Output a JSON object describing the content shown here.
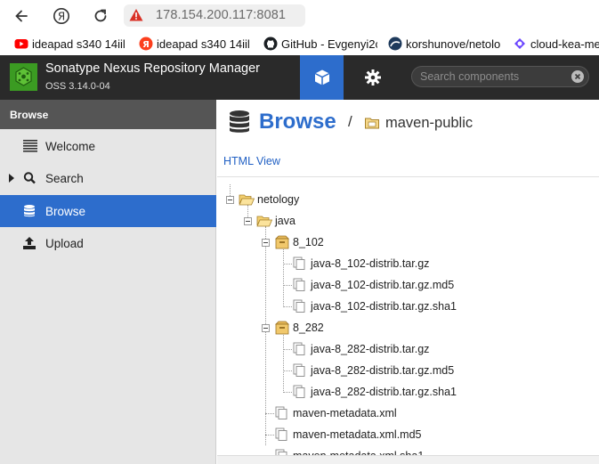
{
  "browser": {
    "url": "178.154.200.117:8081",
    "bookmarks": [
      {
        "label": "ideapad s340 14iil",
        "icon": "youtube-icon"
      },
      {
        "label": "ideapad s340 14iil",
        "icon": "yandex-icon"
      },
      {
        "label": "GitHub - Evgenyi2c",
        "icon": "github-icon"
      },
      {
        "label": "korshunove/netolo",
        "icon": "netology-icon"
      },
      {
        "label": "cloud-kea-me",
        "icon": "cloud-icon"
      }
    ]
  },
  "header": {
    "title": "Sonatype Nexus Repository Manager",
    "version": "OSS 3.14.0-04",
    "search_placeholder": "Search components"
  },
  "sidebar": {
    "heading": "Browse",
    "items": [
      {
        "label": "Welcome",
        "icon": "list-icon"
      },
      {
        "label": "Search",
        "icon": "search-icon"
      },
      {
        "label": "Browse",
        "icon": "database-icon"
      },
      {
        "label": "Upload",
        "icon": "upload-icon"
      }
    ]
  },
  "main": {
    "title": "Browse",
    "separator": "/",
    "repository": "maven-public",
    "html_view": "HTML View",
    "tree": [
      {
        "label": "netology",
        "kind": "folder"
      },
      {
        "label": "java",
        "kind": "folder"
      },
      {
        "label": "8_102",
        "kind": "component"
      },
      {
        "label": "java-8_102-distrib.tar.gz",
        "kind": "asset"
      },
      {
        "label": "java-8_102-distrib.tar.gz.md5",
        "kind": "asset"
      },
      {
        "label": "java-8_102-distrib.tar.gz.sha1",
        "kind": "asset"
      },
      {
        "label": "8_282",
        "kind": "component"
      },
      {
        "label": "java-8_282-distrib.tar.gz",
        "kind": "asset"
      },
      {
        "label": "java-8_282-distrib.tar.gz.md5",
        "kind": "asset"
      },
      {
        "label": "java-8_282-distrib.tar.gz.sha1",
        "kind": "asset"
      },
      {
        "label": "maven-metadata.xml",
        "kind": "asset"
      },
      {
        "label": "maven-metadata.xml.md5",
        "kind": "asset"
      },
      {
        "label": "maven-metadata.xml.sha1",
        "kind": "asset"
      }
    ]
  },
  "colors": {
    "accent": "#2d6dcc",
    "header_bg": "#2a2a2a",
    "sidebar_bg": "#e6e6e6",
    "link": "#2160c4"
  }
}
